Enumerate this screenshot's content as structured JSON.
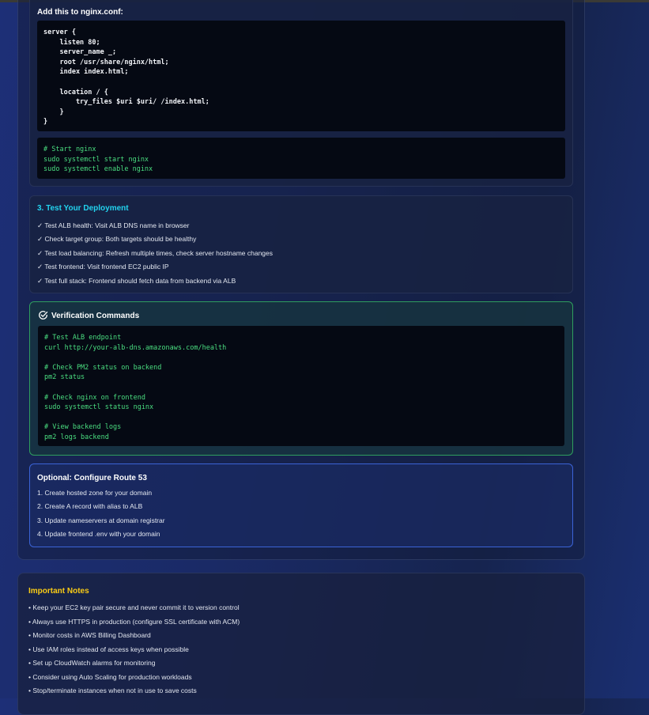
{
  "nginx": {
    "label": "Add this to nginx.conf:",
    "config_code": "server {\n    listen 80;\n    server_name _;\n    root /usr/share/nginx/html;\n    index index.html;\n\n    location / {\n        try_files $uri $uri/ /index.html;\n    }\n}",
    "start_code": "# Start nginx\nsudo systemctl start nginx\nsudo systemctl enable nginx"
  },
  "test": {
    "title": "3. Test Your Deployment",
    "items": [
      "✓ Test ALB health: Visit ALB DNS name in browser",
      "✓ Check target group: Both targets should be healthy",
      "✓ Test load balancing: Refresh multiple times, check server hostname changes",
      "✓ Test frontend: Visit frontend EC2 public IP",
      "✓ Test full stack: Frontend should fetch data from backend via ALB"
    ]
  },
  "verification": {
    "title": "Verification Commands",
    "code": "# Test ALB endpoint\ncurl http://your-alb-dns.amazonaws.com/health\n\n# Check PM2 status on backend\npm2 status\n\n# Check nginx on frontend\nsudo systemctl status nginx\n\n# View backend logs\npm2 logs backend"
  },
  "route53": {
    "title": "Optional: Configure Route 53",
    "items": [
      "1. Create hosted zone for your domain",
      "2. Create A record with alias to ALB",
      "3. Update nameservers at domain registrar",
      "4. Update frontend .env with your domain"
    ]
  },
  "notes": {
    "title": "Important Notes",
    "items": [
      "• Keep your EC2 key pair secure and never commit it to version control",
      "• Always use HTTPS in production (configure SSL certificate with ACM)",
      "• Monitor costs in AWS Billing Dashboard",
      "• Use IAM roles instead of access keys when possible",
      "• Set up CloudWatch alarms for monitoring",
      "• Consider using Auto Scaling for production workloads",
      "• Stop/terminate instances when not in use to save costs"
    ]
  },
  "colors": {
    "test_title": "#22d3ee",
    "notes_title": "#facc15",
    "code_comment": "#4ade80",
    "verify_border": "#2f9e5e",
    "route_border": "#3b63d6"
  },
  "icons": {
    "verification": "check-circle-icon"
  }
}
